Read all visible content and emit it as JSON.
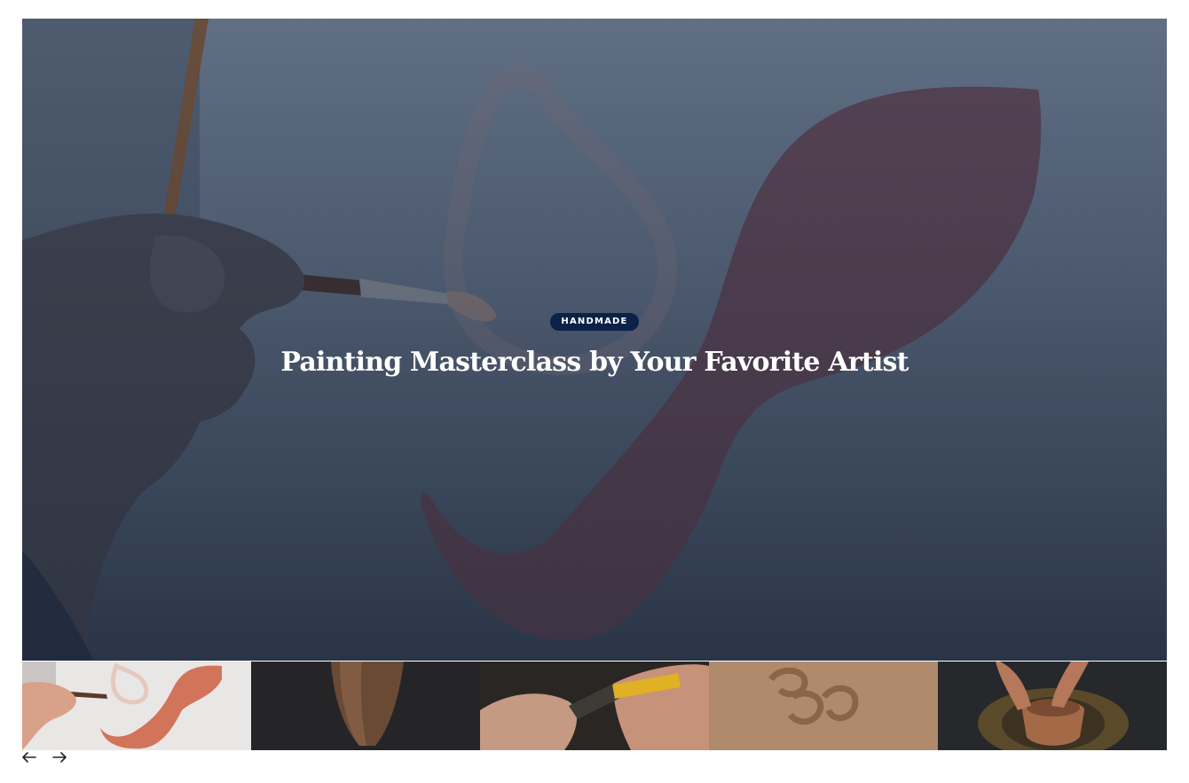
{
  "slide": {
    "category": "HANDMADE",
    "title": "Painting Masterclass by Your Favorite Artist"
  },
  "thumbnails": [
    {
      "subject": "painting"
    },
    {
      "subject": "wood-vase"
    },
    {
      "subject": "engraving-tool"
    },
    {
      "subject": "sand-drawing"
    },
    {
      "subject": "pottery-wheel"
    }
  ],
  "navigation": {
    "prev_icon": "arrow-left-icon",
    "next_icon": "arrow-right-icon"
  }
}
